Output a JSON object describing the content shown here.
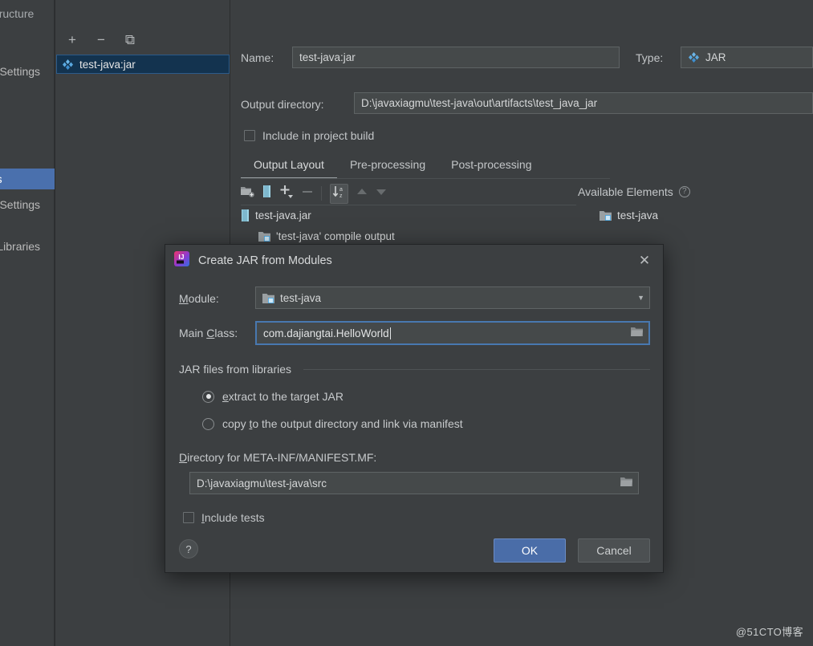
{
  "background_window": {
    "sidebar": {
      "title": "Project Structure",
      "items": [
        {
          "label": "Project Settings",
          "selected": false
        },
        {
          "label": "Artifacts",
          "selected": true
        },
        {
          "label": "SDKs / Settings",
          "selected": false
        },
        {
          "label": "Global Libraries",
          "selected": false
        }
      ]
    },
    "artifacts_pane": {
      "toolbar": [
        {
          "icon": "plus-icon",
          "label": "+"
        },
        {
          "icon": "minus-icon",
          "label": "−"
        },
        {
          "icon": "copy-icon",
          "label": "⧉"
        }
      ],
      "selected_artifact": "test-java:jar"
    },
    "detail": {
      "name_label": "Name:",
      "name_value": "test-java:jar",
      "type_label": "Type:",
      "type_value": "JAR",
      "output_directory_label": "Output directory:",
      "output_directory_value": "D:\\javaxiagmu\\test-java\\out\\artifacts\\test_java_jar",
      "include_in_build_label": "Include in project build",
      "include_in_build_checked": false,
      "tabs": [
        {
          "label": "Output Layout",
          "active": true
        },
        {
          "label": "Pre-processing",
          "active": false
        },
        {
          "label": "Post-processing",
          "active": false
        }
      ],
      "layout_toolbar": [
        {
          "icon": "add-directory-icon"
        },
        {
          "icon": "add-archive-icon"
        },
        {
          "icon": "add-dropdown-icon"
        },
        {
          "icon": "remove-icon"
        },
        {
          "icon": "sort-alphabetically-icon"
        },
        {
          "icon": "move-up-icon"
        },
        {
          "icon": "move-down-icon"
        }
      ],
      "tree": [
        {
          "label": "test-java.jar",
          "icon": "archive-icon",
          "indent": 0
        },
        {
          "label": "'test-java' compile output",
          "icon": "module-icon",
          "indent": 1
        }
      ],
      "available_elements_label": "Available Elements",
      "available_elements": [
        {
          "label": "test-java",
          "icon": "module-icon"
        }
      ]
    }
  },
  "dialog": {
    "title": "Create JAR from Modules",
    "app_icon": "intellij-idea-icon",
    "close_icon": "close-icon",
    "module_label": "Module:",
    "module_label_mnemonic": "M",
    "module_value": "test-java",
    "module_icon": "module-icon",
    "dropdown_icon": "chevron-down-icon",
    "main_class_label": "Main Class:",
    "main_class_value": "com.dajiangtai.HelloWorld",
    "main_class_browse_icon": "folder-browse-icon",
    "jar_files_group_label": "JAR files from libraries",
    "radio_options": [
      {
        "label": "extract to the target JAR",
        "selected": true
      },
      {
        "label": "copy to the output directory and link via manifest",
        "selected": false
      }
    ],
    "manifest_dir_label": "Directory for META-INF/MANIFEST.MF:",
    "manifest_dir_value": "D:\\javaxiagmu\\test-java\\src",
    "manifest_browse_icon": "folder-browse-icon",
    "include_tests_label": "Include tests",
    "include_tests_checked": false,
    "help_icon": "question-mark-icon",
    "ok_label": "OK",
    "cancel_label": "Cancel"
  },
  "watermark": "@51CTO博客",
  "colors": {
    "window_bg": "#3c3f41",
    "field_bg": "#45494a",
    "accent_blue": "#4a6da8",
    "focus_border": "#4878b0",
    "selection_blue": "#4a70ad",
    "tree_selection": "#13334f"
  }
}
